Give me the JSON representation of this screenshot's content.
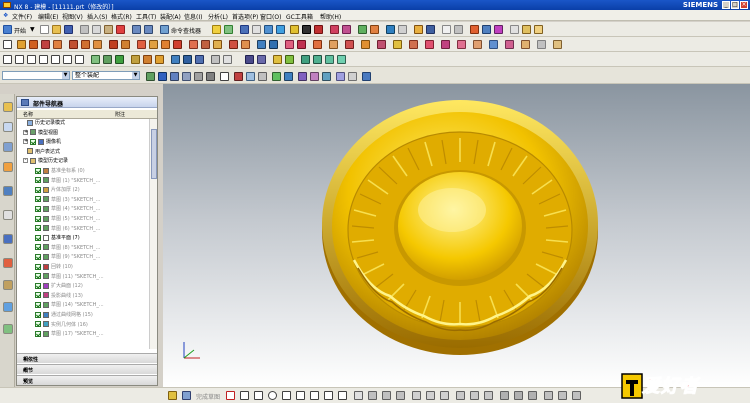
{
  "window": {
    "title": "NX 8 - 建模 - [11111.prt（修改的）]",
    "brand": "SIEMENS",
    "minimize": "_",
    "maximize": "□",
    "close": "×"
  },
  "menu": [
    "文件(F)",
    "编辑(E)",
    "视图(V)",
    "插入(S)",
    "格式(R)",
    "工具(T)",
    "装配(A)",
    "信息(I)",
    "分析(L)",
    "首选项(P)",
    "窗口(O)",
    "GC工具箱",
    "帮助(H)"
  ],
  "toolbar": {
    "start_label": "开始",
    "command_finder_label": "命令查找器",
    "menu_arrow": "▼"
  },
  "selection": {
    "filter_value": "",
    "scope_value": "整个装配",
    "arrow": "▼"
  },
  "navigator": {
    "title": "部件导航器",
    "col_name": "名称",
    "col_attached": "附注",
    "rows": [
      {
        "indent": 8,
        "kind": "plain",
        "text": "历史记录模式",
        "gray": false,
        "ico": "#8ab0e0"
      },
      {
        "indent": 4,
        "kind": "expand",
        "text": "模型视图",
        "gray": false,
        "ico": "#6aa06a"
      },
      {
        "indent": 4,
        "kind": "expandcheck",
        "text": "摄像机",
        "gray": false,
        "ico": "#4a70c0"
      },
      {
        "indent": 8,
        "kind": "plain",
        "text": "用户表达式",
        "gray": false,
        "ico": "#e0c070"
      },
      {
        "indent": 4,
        "kind": "collapse",
        "text": "模型历史记录",
        "gray": false,
        "ico": "#e0c070"
      },
      {
        "indent": 16,
        "kind": "check",
        "text": "基准坐标系 (0)",
        "gray": true,
        "ico": "#c08040"
      },
      {
        "indent": 16,
        "kind": "check",
        "text": "草图 (1) \"SKETCH_...",
        "gray": true,
        "ico": "#60a060"
      },
      {
        "indent": 16,
        "kind": "check",
        "text": "片体加厚 (2)",
        "gray": true,
        "ico": "#d0a040"
      },
      {
        "indent": 16,
        "kind": "check",
        "text": "草图 (3) \"SKETCH_...",
        "gray": true,
        "ico": "#60a060"
      },
      {
        "indent": 16,
        "kind": "check",
        "text": "草图 (4) \"SKETCH_...",
        "gray": true,
        "ico": "#60a060"
      },
      {
        "indent": 16,
        "kind": "check",
        "text": "草图 (5) \"SKETCH_...",
        "gray": true,
        "ico": "#60a060"
      },
      {
        "indent": 16,
        "kind": "check",
        "text": "草图 (6) \"SKETCH_...",
        "gray": true,
        "ico": "#60a060"
      },
      {
        "indent": 16,
        "kind": "plaincb",
        "text": "基准平面 (7)",
        "gray": false,
        "ico": "#ffffff"
      },
      {
        "indent": 16,
        "kind": "check",
        "text": "草图 (8) \"SKETCH_...",
        "gray": true,
        "ico": "#60a060"
      },
      {
        "indent": 16,
        "kind": "check",
        "text": "草图 (9) \"SKETCH_...",
        "gray": true,
        "ico": "#60a060"
      },
      {
        "indent": 16,
        "kind": "check",
        "text": "回转 (10)",
        "gray": true,
        "ico": "#c04040"
      },
      {
        "indent": 16,
        "kind": "check",
        "text": "草图 (11) \"SKETCH_...",
        "gray": true,
        "ico": "#60a060"
      },
      {
        "indent": 16,
        "kind": "check",
        "text": "扩大曲面 (12)",
        "gray": true,
        "ico": "#a040c0"
      },
      {
        "indent": 16,
        "kind": "check",
        "text": "投影曲线 (13)",
        "gray": true,
        "ico": "#c04080"
      },
      {
        "indent": 16,
        "kind": "check",
        "text": "草图 (14) \"SKETCH_...",
        "gray": true,
        "ico": "#60a060"
      },
      {
        "indent": 16,
        "kind": "check",
        "text": "通过曲线网格 (15)",
        "gray": true,
        "ico": "#4080c0"
      },
      {
        "indent": 16,
        "kind": "check",
        "text": "实例几何体 (16)",
        "gray": true,
        "ico": "#40a0c0"
      },
      {
        "indent": 16,
        "kind": "check",
        "text": "草图 (17) \"SKETCH_...",
        "gray": true,
        "ico": "#60a060"
      }
    ],
    "panels": [
      "相依性",
      "细节",
      "预览"
    ],
    "panel_chevron": "∨"
  },
  "statusbar": {
    "snap_label": "完成草图"
  },
  "logo": {
    "text": "爱好者"
  },
  "colors": {
    "coin_light": "#ffe24a",
    "coin_mid": "#f2c200",
    "coin_dark": "#b08400",
    "title_blue": "#0a3fa8"
  }
}
